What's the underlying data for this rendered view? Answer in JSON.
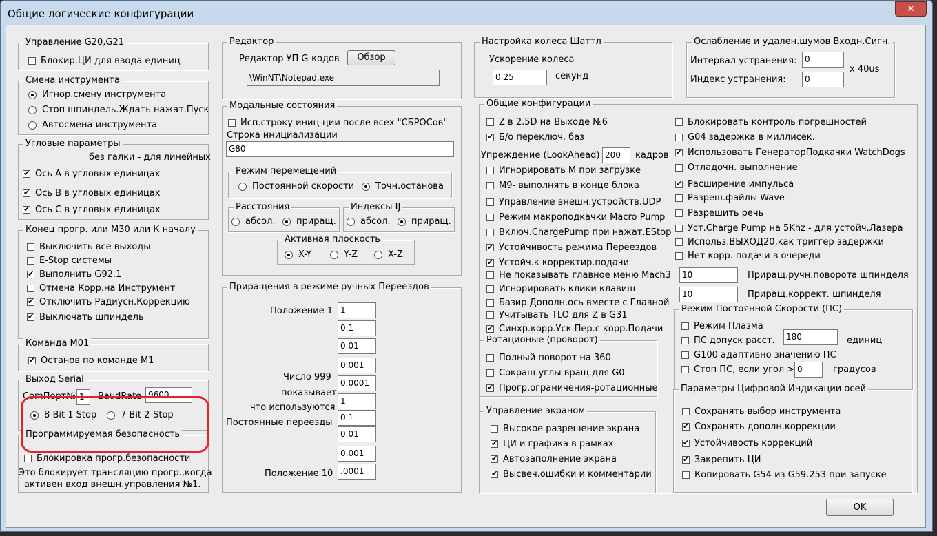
{
  "window": {
    "title": "Общие логические конфигурации",
    "close_glyph": "✕"
  },
  "g20": {
    "title": "Управление G20,G21",
    "lock_label": "Блокир.ЦИ для ввода единиц"
  },
  "toolchange": {
    "title": "Смена инструмента",
    "options": [
      "Игнор.смену инструмента",
      "Стоп шпиндель.Ждать нажат.Пуск",
      "Автосмена инструмента"
    ]
  },
  "angular": {
    "title": "Угловые параметры",
    "note": "без галки - для линейных",
    "items": [
      "Ось А в угловых единицах",
      "Ось В в угловых единицах",
      "Ось С в угловых единицах"
    ]
  },
  "endprog": {
    "title": "Конец прогр. или М30 или К началу",
    "items": [
      "Выключить все выходы",
      "E-Stop системы",
      "Выполнить G92.1",
      "Отмена Корр.на Инструмент",
      "Отключить Радиусн.Коррекцию",
      "Выключать шпиндель"
    ]
  },
  "m01": {
    "title": "Команда М01",
    "item": "Останов по команде М1"
  },
  "serial": {
    "title": "Выход Serial",
    "comport_label": "ComПорт№",
    "comport_value": "1",
    "baud_label": "BaudRate",
    "baud_value": "9600",
    "opt1": "8-Bit 1 Stop",
    "opt2": "7 Bit 2-Stop"
  },
  "safety": {
    "title": "Программируемая безопасность",
    "item": "Блокировка прогр.безопасности",
    "note1": "Это блокирует трансляцию прогр.,когда",
    "note2": "активен вход внешн.управления №1."
  },
  "editor": {
    "title": "Редактор",
    "label": "Редактор УП G-кодов",
    "browse": "Обзор",
    "path": "\\WinNT\\Notepad.exe"
  },
  "modal": {
    "title": "Модальные состояния",
    "reset_use": "Исп.строку иниц-ции после всех \"СБРОСов\"",
    "init_label": "Строка инициализации",
    "init_value": "G80",
    "motion": {
      "title": "Режим перемещений",
      "opt1": "Постоянной скорости",
      "opt2": "Точн.останова"
    },
    "dist": {
      "title": "Расстояния",
      "opt1": "абсол.",
      "opt2": "приращ."
    },
    "ij": {
      "title": "Индексы IJ",
      "opt1": "абсол.",
      "opt2": "приращ."
    },
    "plane": {
      "title": "Активная плоскость",
      "opt1": "X-Y",
      "opt2": "Y-Z",
      "opt3": "X-Z"
    }
  },
  "jog": {
    "title": "Приращения в режиме ручных Переездов",
    "pos1": "Положение 1",
    "pos10": "Положение 10",
    "n999a": "Число 999",
    "n999b": "показывает,",
    "n999c": "что используются",
    "n999d": "Постоянные переезды",
    "values": [
      "1",
      "0.1",
      "0.01",
      "0.001",
      "0.0001",
      "1",
      "0.1",
      "0.01",
      "0.001",
      ".0001"
    ]
  },
  "wheel": {
    "title": "Настройка колеса Шаттл",
    "accel_label": "Ускорение колеса",
    "accel_value": "0.25",
    "unit": "секунд"
  },
  "debounce": {
    "title": "Ослабление и удален.шумов Входн.Сигн.",
    "interval_label": "Интервал устранения:",
    "interval_value": "0",
    "index_label": "Индекс устранения:",
    "index_value": "0",
    "unit": "x 40us"
  },
  "general": {
    "title": "Общие конфигурации",
    "z25": "Z в 2.5D на Выходе №6",
    "nohome": "Б/о переключ. баз",
    "lookahead_label": "Упреждение (LookAhead)",
    "lookahead_value": "200",
    "lookahead_unit": "кадров",
    "left": [
      "Игнорировать М при загрузке",
      "М9- выполнять в конце блока",
      "Управление внешн.устройств.UDP",
      "Режим макроподкачки Macro Pump",
      "Включ.ChargePump при нажат.EStop",
      "Устойчивость режима Переездов",
      "Устойч.к корректир.подачи",
      "Не показывать главное меню Mach3",
      "Игнорировать клики клавиш",
      "Базир.Дополн.ось вместе с Главной",
      "Учитывать TLO для Z в G31",
      "Синхр.корр.Уск.Пер.с корр.Подачи"
    ],
    "right": [
      "Блокировать контроль погрешностей",
      "G04 задержка в миллисек.",
      "Использовать ГенераторПодкачки WatchDogs",
      "Отладочн. выполнение",
      "Расширение импульса",
      "Разреш.файлы Wave",
      "Разрешить речь",
      "Уст.Charge Pump на 5Khz  - для устойч.Лазера",
      "Использ.ВЫХОД20,как триггер задержки",
      "Нет корр. подачи в очереди"
    ],
    "spin_inc_value": "10",
    "spin_inc_label": "Приращ.ручн.поворота шпинделя",
    "spin_corr_value": "10",
    "spin_corr_label": "Приращ.коррект. шпинделя"
  },
  "rotary": {
    "title": "Ротационые (проворот)",
    "items": [
      "Полный поворот на 360",
      "Сокращ.углы вращ.для G0",
      "Прогр.ограничения-ротационные"
    ]
  },
  "css": {
    "title": "Режим Постоянной Скорости (ПС)",
    "plasma": "Режим Плазма",
    "dist_label": "ПС допуск расст.",
    "dist_value": "180",
    "dist_unit": "единиц",
    "g100": "G100 адаптивно значению ПС",
    "stop_label": "Стоп ПС, если угол >",
    "stop_value": "0",
    "stop_unit": "градусов"
  },
  "screen": {
    "title": "Управление экраном",
    "items": [
      "Высокое разрешение экрана",
      "ЦИ и графика в рамках",
      "Автозаполнение экрана",
      "Высвеч.ошибки и комментарии"
    ]
  },
  "dro": {
    "title": "Параметры Цифровой Индикации осей",
    "items": [
      "Сохранять выбор инструмента",
      "Сохранять дополн.коррекции",
      "Устойчивость коррекций",
      "Закрепить ЦИ",
      "Копировать G54 из G59.253 при запуске"
    ]
  },
  "ok": "OK",
  "colors": {
    "highlight": "#e3222a",
    "window_frame": "#c9d9ec",
    "face": "#ececec"
  }
}
